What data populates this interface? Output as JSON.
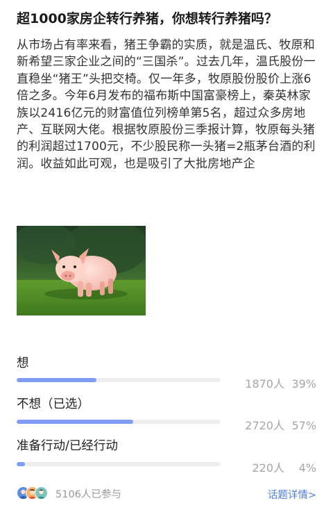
{
  "post": {
    "title": "超1000家房企转行养猪，你想转行养猪吗？",
    "body": "从市场占有率来看，猪王争霸的实质，就是温氏、牧原和新希望三家企业之间的“三国杀”。过去几年，温氏股份一直稳坐“猪王”头把交椅。仅一年多，牧原股份股价上涨6倍之多。今年6月发布的福布斯中国富豪榜上，秦英林家族以2416亿元的财富值位列榜单第5名，超过众多房地产、互联网大佬。根据牧原股份三季报计算，牧原每头猪的利润超过1700元，不少股民称一头猪=2瓶茅台酒的利润。收益如此可观，也是吸引了大批房地产企"
  },
  "poll": {
    "options": [
      {
        "label": "想",
        "count": "1870人",
        "percent_text": "39%",
        "percent": 39
      },
      {
        "label": "不想（已选）",
        "count": "2720人",
        "percent_text": "57%",
        "percent": 57
      },
      {
        "label": "准备行动/已经行动",
        "count": "220人",
        "percent_text": "4%",
        "percent": 4
      }
    ],
    "participants_text": "5106人已参与",
    "details_link": "话题详情>"
  },
  "colors": {
    "bar_fill": "#7f9cf7",
    "bar_track": "#eeeeee",
    "link": "#4f7fe8",
    "stat_text": "#a6a6a6"
  },
  "icons": {
    "avatars": [
      "avatar-blue-icon",
      "avatar-face-icon",
      "avatar-teal-icon"
    ]
  }
}
